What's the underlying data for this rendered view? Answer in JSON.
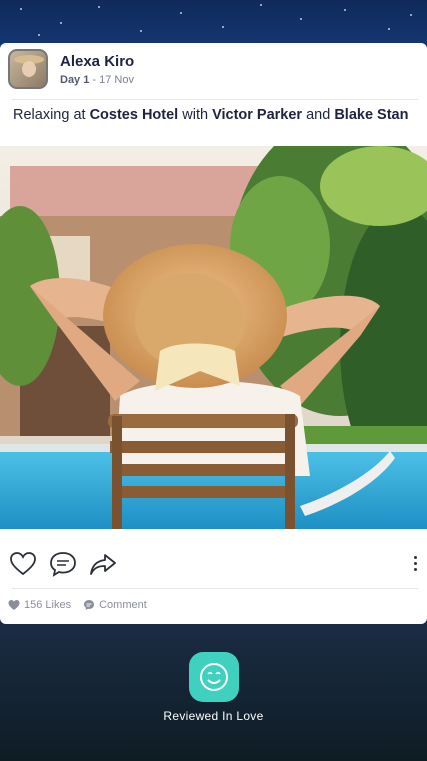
{
  "post": {
    "author_name": "Alexa Kiro",
    "day_label": "Day 1",
    "date_separator": " - ",
    "date": "17 Nov",
    "caption": {
      "prefix": "Relaxing at ",
      "place": "Costes Hotel",
      "with": " with ",
      "person1": "Victor Parker",
      "and": " and ",
      "person2": "Blake Stan"
    },
    "likes": "156 Likes",
    "comment_label": "Comment"
  },
  "icons": [
    "heart-icon",
    "comment-icon",
    "share-icon",
    "more-vertical-icon",
    "heart-small-icon",
    "comment-small-icon",
    "smiley-icon"
  ],
  "review": {
    "label": "Reviewed In Love"
  },
  "colors": {
    "review_accent": "#3fd0bf",
    "text_primary": "#1e2340",
    "text_muted": "#8a8e9a"
  }
}
